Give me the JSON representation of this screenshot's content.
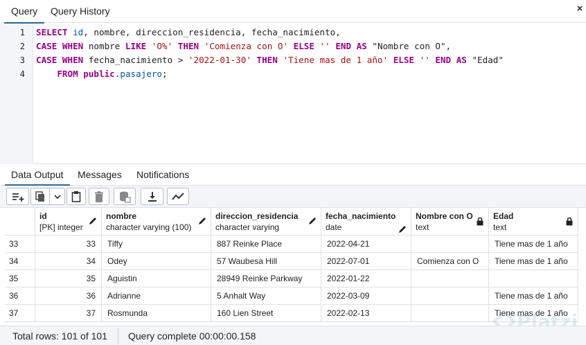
{
  "top_tabs": [
    {
      "label": "Query",
      "active": true
    },
    {
      "label": "Query History",
      "active": false
    }
  ],
  "editor": {
    "line_numbers": [
      "1",
      "2",
      "3",
      "4"
    ],
    "lines": [
      [
        {
          "t": "SELECT ",
          "c": "kw"
        },
        {
          "t": "id",
          "c": "id"
        },
        {
          "t": ", ",
          "c": "pl"
        },
        {
          "t": "nombre",
          "c": "pl"
        },
        {
          "t": ", ",
          "c": "pl"
        },
        {
          "t": "direccion_residencia",
          "c": "pl"
        },
        {
          "t": ", ",
          "c": "pl"
        },
        {
          "t": "fecha_nacimiento",
          "c": "pl"
        },
        {
          "t": ",",
          "c": "pl"
        }
      ],
      [
        {
          "t": "CASE ",
          "c": "kw"
        },
        {
          "t": "WHEN ",
          "c": "kw"
        },
        {
          "t": "nombre ",
          "c": "pl"
        },
        {
          "t": "LIKE ",
          "c": "kw"
        },
        {
          "t": "'O%'",
          "c": "str"
        },
        {
          "t": " ",
          "c": "pl"
        },
        {
          "t": "THEN ",
          "c": "kw"
        },
        {
          "t": "'Comienza con O'",
          "c": "str"
        },
        {
          "t": " ",
          "c": "pl"
        },
        {
          "t": "ELSE ",
          "c": "kw"
        },
        {
          "t": "''",
          "c": "str"
        },
        {
          "t": " ",
          "c": "pl"
        },
        {
          "t": "END ",
          "c": "kw"
        },
        {
          "t": "AS ",
          "c": "kw"
        },
        {
          "t": "\"Nombre con O\",",
          "c": "pl"
        }
      ],
      [
        {
          "t": "CASE ",
          "c": "kw"
        },
        {
          "t": "WHEN ",
          "c": "kw"
        },
        {
          "t": "fecha_nacimiento ",
          "c": "pl"
        },
        {
          "t": "> ",
          "c": "op"
        },
        {
          "t": "'2022-01-30'",
          "c": "str"
        },
        {
          "t": " ",
          "c": "pl"
        },
        {
          "t": "THEN ",
          "c": "kw"
        },
        {
          "t": "'Tiene mas de 1 año'",
          "c": "str"
        },
        {
          "t": " ",
          "c": "pl"
        },
        {
          "t": "ELSE ",
          "c": "kw"
        },
        {
          "t": "''",
          "c": "str"
        },
        {
          "t": " ",
          "c": "pl"
        },
        {
          "t": "END ",
          "c": "kw"
        },
        {
          "t": "AS ",
          "c": "kw"
        },
        {
          "t": "\"Edad\"",
          "c": "pl"
        }
      ],
      [
        {
          "t": "    ",
          "c": "pl"
        },
        {
          "t": "FROM ",
          "c": "kw"
        },
        {
          "t": "public",
          "c": "kw"
        },
        {
          "t": ".",
          "c": "pl"
        },
        {
          "t": "pasajero",
          "c": "id"
        },
        {
          "t": ";",
          "c": "pl"
        }
      ]
    ]
  },
  "bottom_tabs": [
    {
      "label": "Data Output",
      "active": true
    },
    {
      "label": "Messages",
      "active": false
    },
    {
      "label": "Notifications",
      "active": false
    }
  ],
  "toolbar": {
    "icons": [
      "add-row-icon",
      "copy-icon",
      "dropdown-chevron-icon",
      "paste-icon",
      "delete-icon",
      "save-data-icon",
      "download-icon",
      "graph-icon"
    ]
  },
  "columns": [
    {
      "name": "id",
      "type": "[PK] integer",
      "icon": "pencil-icon"
    },
    {
      "name": "nombre",
      "type": "character varying (100)",
      "icon": "pencil-icon"
    },
    {
      "name": "direccion_residencia",
      "type": "character varying",
      "icon": "pencil-icon"
    },
    {
      "name": "fecha_nacimiento",
      "type": "date",
      "icon": "pencil-icon"
    },
    {
      "name": "Nombre con O",
      "type": "text",
      "icon": "lock-icon"
    },
    {
      "name": "Edad",
      "type": "text",
      "icon": "lock-icon"
    }
  ],
  "rows": [
    {
      "n": "33",
      "id": "33",
      "nombre": "Tiffy",
      "dir": "887 Reinke Place",
      "fecha": "2022-04-21",
      "nco": "",
      "edad": "Tiene mas de 1 año"
    },
    {
      "n": "34",
      "id": "34",
      "nombre": "Odey",
      "dir": "57 Waubesa Hill",
      "fecha": "2022-07-01",
      "nco": "Comienza con O",
      "edad": "Tiene mas de 1 año"
    },
    {
      "n": "35",
      "id": "35",
      "nombre": "Aguistin",
      "dir": "28949 Reinke Parkway",
      "fecha": "2022-01-22",
      "nco": "",
      "edad": ""
    },
    {
      "n": "36",
      "id": "36",
      "nombre": "Adrianne",
      "dir": "5 Anhalt Way",
      "fecha": "2022-03-09",
      "nco": "",
      "edad": "Tiene mas de 1 año"
    },
    {
      "n": "37",
      "id": "37",
      "nombre": "Rosmunda",
      "dir": "160 Lien Street",
      "fecha": "2022-02-13",
      "nco": "",
      "edad": "Tiene mas de 1 año"
    }
  ],
  "status": {
    "total_rows": "Total rows: 101 of 101",
    "query_complete": "Query complete 00:00:00.158"
  },
  "watermark": {
    "text": "Platzi"
  },
  "colors": {
    "accent": "#326690",
    "keyword": "#990088",
    "string": "#aa1111",
    "identifier": "#0055aa"
  }
}
